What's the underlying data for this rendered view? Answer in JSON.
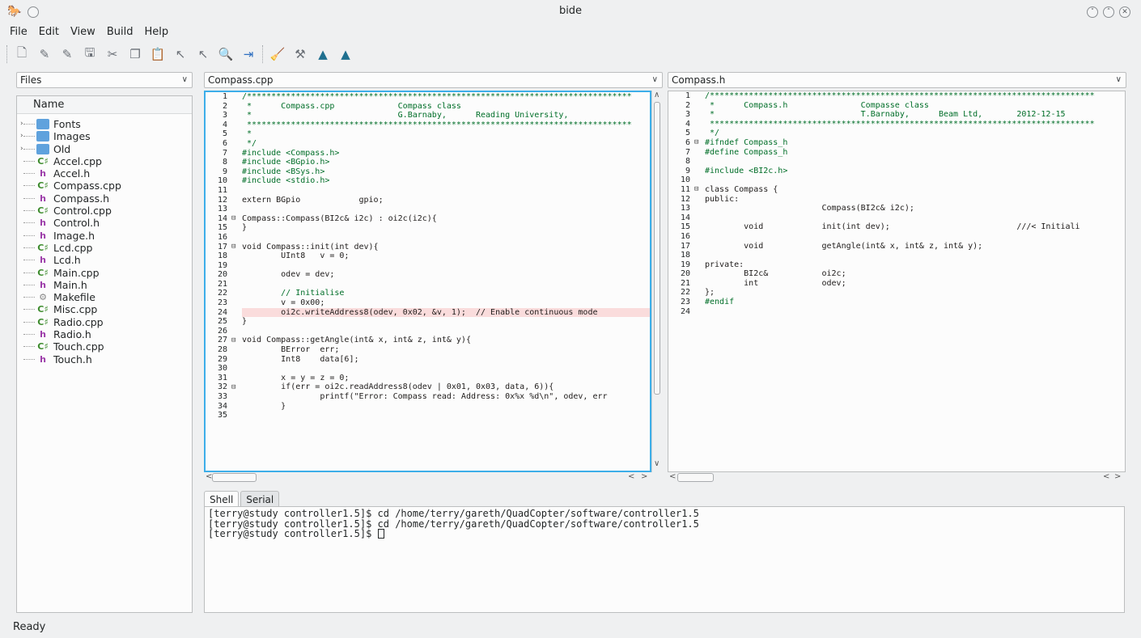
{
  "window": {
    "title": "bide",
    "controls": [
      "chevron-down-icon",
      "chevron-up-icon",
      "close-icon"
    ]
  },
  "menu": [
    {
      "label": "File"
    },
    {
      "label": "Edit"
    },
    {
      "label": "View"
    },
    {
      "label": "Build"
    },
    {
      "label": "Help"
    }
  ],
  "toolbar": [
    "new-file-icon",
    "open-icon",
    "open-recent-icon",
    "save-icon",
    "cut-icon",
    "copy-icon",
    "paste-icon",
    "select-icon",
    "find-icon",
    "search-icon",
    "goto-icon",
    "build-icon",
    "tools-icon",
    "run-icon",
    "debug-icon"
  ],
  "files": {
    "combo_label": "Files",
    "header": "Name",
    "items": [
      {
        "name": "Fonts",
        "type": "folder"
      },
      {
        "name": "Images",
        "type": "folder"
      },
      {
        "name": "Old",
        "type": "folder"
      },
      {
        "name": "Accel.cpp",
        "type": "cpp"
      },
      {
        "name": "Accel.h",
        "type": "h"
      },
      {
        "name": "Compass.cpp",
        "type": "cpp"
      },
      {
        "name": "Compass.h",
        "type": "h"
      },
      {
        "name": "Control.cpp",
        "type": "cpp"
      },
      {
        "name": "Control.h",
        "type": "h"
      },
      {
        "name": "Image.h",
        "type": "h"
      },
      {
        "name": "Lcd.cpp",
        "type": "cpp"
      },
      {
        "name": "Lcd.h",
        "type": "h"
      },
      {
        "name": "Main.cpp",
        "type": "cpp"
      },
      {
        "name": "Main.h",
        "type": "h"
      },
      {
        "name": "Makefile",
        "type": "make"
      },
      {
        "name": "Misc.cpp",
        "type": "cpp"
      },
      {
        "name": "Radio.cpp",
        "type": "cpp"
      },
      {
        "name": "Radio.h",
        "type": "h"
      },
      {
        "name": "Touch.cpp",
        "type": "cpp"
      },
      {
        "name": "Touch.h",
        "type": "h"
      }
    ]
  },
  "editor_left": {
    "file": "Compass.cpp",
    "lines": [
      "/*******************************************************************************",
      " *      Compass.cpp             Compass class",
      " *                              G.Barnaby,      Reading University,",
      " *******************************************************************************",
      " *",
      " */",
      "#include <Compass.h>",
      "#include <BGpio.h>",
      "#include <BSys.h>",
      "#include <stdio.h>",
      "",
      "extern BGpio            gpio;",
      "",
      "Compass::Compass(BI2c& i2c) : oi2c(i2c){",
      "}",
      "",
      "void Compass::init(int dev){",
      "        UInt8   v = 0;",
      "",
      "        odev = dev;",
      "",
      "        // Initialise",
      "        v = 0x00;",
      "        oi2c.writeAddress8(odev, 0x02, &v, 1);  // Enable continuous mode",
      "}",
      "",
      "void Compass::getAngle(int& x, int& z, int& y){",
      "        BError  err;",
      "        Int8    data[6];",
      "",
      "        x = y = z = 0;",
      "        if(err = oi2c.readAddress8(odev | 0x01, 0x03, data, 6)){",
      "                printf(\"Error: Compass read: Address: 0x%x %d\\n\", odev, err",
      "        }",
      ""
    ]
  },
  "editor_right": {
    "file": "Compass.h",
    "lines": [
      "/*******************************************************************************",
      " *      Compass.h               Compasse class",
      " *                              T.Barnaby,      Beam Ltd,       2012-12-15",
      " *******************************************************************************",
      " */",
      "#ifndef Compass_h",
      "#define Compass_h",
      "",
      "#include <BI2c.h>",
      "",
      "class Compass {",
      "public:",
      "                        Compass(BI2c& i2c);",
      "",
      "        void            init(int dev);                          ///< Initiali",
      "",
      "        void            getAngle(int& x, int& z, int& y);",
      "",
      "private:",
      "        BI2c&           oi2c;",
      "        int             odev;",
      "};",
      "#endif",
      ""
    ]
  },
  "bottom_tabs": [
    {
      "label": "Shell"
    },
    {
      "label": "Serial"
    }
  ],
  "shell": {
    "lines": [
      "[terry@study controller1.5]$ cd /home/terry/gareth/QuadCopter/software/controller1.5",
      "[terry@study controller1.5]$ cd /home/terry/gareth/QuadCopter/software/controller1.5",
      "[terry@study controller1.5]$ "
    ]
  },
  "status": "Ready",
  "colors": {
    "accent": "#3daee9",
    "comment": "#006e28",
    "keyword": "#1f1c1b",
    "preproc": "#006e28",
    "number": "#b08000",
    "string": "#bf0303",
    "type": "#0057ae",
    "highlight_line": "#fadcdc"
  }
}
